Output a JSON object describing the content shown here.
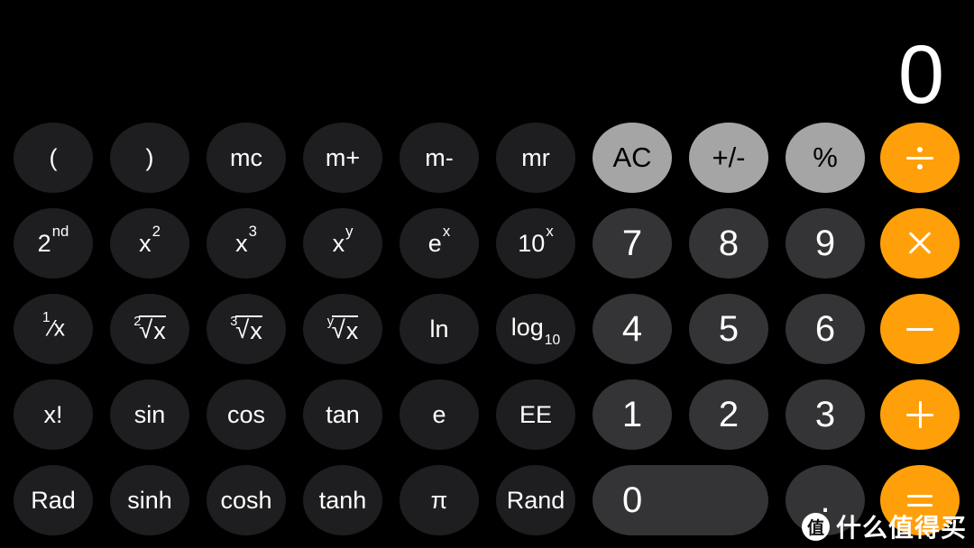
{
  "app": {
    "name": "Calculator",
    "mode": "scientific",
    "orientation": "landscape"
  },
  "display": {
    "value": "0"
  },
  "colors": {
    "background": "#000000",
    "function_key": "#1e1e20",
    "digit_key": "#343436",
    "clear_key": "#a5a5a5",
    "accent_operator": "#ff9f0a",
    "text_light": "#ffffff",
    "text_dark": "#000000"
  },
  "keypad": {
    "rows": [
      {
        "keys": [
          {
            "name": "open-paren",
            "label": "(",
            "style": "function"
          },
          {
            "name": "close-paren",
            "label": ")",
            "style": "function"
          },
          {
            "name": "memory-clear",
            "label": "mc",
            "style": "function"
          },
          {
            "name": "memory-add",
            "label": "m+",
            "style": "function"
          },
          {
            "name": "memory-subtract",
            "label": "m-",
            "style": "function"
          },
          {
            "name": "memory-recall",
            "label": "mr",
            "style": "function"
          },
          {
            "name": "all-clear",
            "label": "AC",
            "style": "gray"
          },
          {
            "name": "plus-minus",
            "label": "+/-",
            "style": "gray"
          },
          {
            "name": "percent",
            "label": "%",
            "style": "gray"
          },
          {
            "name": "divide",
            "label": "÷",
            "style": "accent",
            "glyph": "divide-icon"
          }
        ]
      },
      {
        "keys": [
          {
            "name": "second-function",
            "label": "2nd",
            "base": "2",
            "sup": "nd",
            "style": "function"
          },
          {
            "name": "x-squared",
            "label": "x²",
            "base": "x",
            "sup": "2",
            "style": "function"
          },
          {
            "name": "x-cubed",
            "label": "x³",
            "base": "x",
            "sup": "3",
            "style": "function"
          },
          {
            "name": "x-to-the-y",
            "label": "xʸ",
            "base": "x",
            "sup": "y",
            "style": "function"
          },
          {
            "name": "e-to-the-x",
            "label": "eˣ",
            "base": "e",
            "sup": "x",
            "style": "function"
          },
          {
            "name": "ten-to-the-x",
            "label": "10ˣ",
            "base": "10",
            "sup": "x",
            "style": "function"
          },
          {
            "name": "digit-7",
            "label": "7",
            "style": "digit"
          },
          {
            "name": "digit-8",
            "label": "8",
            "style": "digit"
          },
          {
            "name": "digit-9",
            "label": "9",
            "style": "digit"
          },
          {
            "name": "multiply",
            "label": "×",
            "style": "accent",
            "glyph": "multiply-icon"
          }
        ]
      },
      {
        "keys": [
          {
            "name": "reciprocal",
            "label": "¹⁄x",
            "style": "function",
            "kind": "fraction",
            "numerator": "1",
            "denominator": "x"
          },
          {
            "name": "square-root",
            "label": "²√x",
            "style": "function",
            "kind": "radical",
            "index": "2",
            "radicand": "x"
          },
          {
            "name": "cube-root",
            "label": "³√x",
            "style": "function",
            "kind": "radical",
            "index": "3",
            "radicand": "x"
          },
          {
            "name": "y-root",
            "label": "ʸ√x",
            "style": "function",
            "kind": "radical",
            "index": "y",
            "radicand": "x"
          },
          {
            "name": "natural-log",
            "label": "ln",
            "style": "function"
          },
          {
            "name": "log-base-ten",
            "label": "log₁₀",
            "base": "log",
            "sub": "10",
            "style": "function"
          },
          {
            "name": "digit-4",
            "label": "4",
            "style": "digit"
          },
          {
            "name": "digit-5",
            "label": "5",
            "style": "digit"
          },
          {
            "name": "digit-6",
            "label": "6",
            "style": "digit"
          },
          {
            "name": "subtract",
            "label": "−",
            "style": "accent",
            "glyph": "minus-icon"
          }
        ]
      },
      {
        "keys": [
          {
            "name": "factorial",
            "label": "x!",
            "style": "function"
          },
          {
            "name": "sine",
            "label": "sin",
            "style": "function"
          },
          {
            "name": "cosine",
            "label": "cos",
            "style": "function"
          },
          {
            "name": "tangent",
            "label": "tan",
            "style": "function"
          },
          {
            "name": "euler-constant",
            "label": "e",
            "style": "function"
          },
          {
            "name": "exponent-entry",
            "label": "EE",
            "style": "function"
          },
          {
            "name": "digit-1",
            "label": "1",
            "style": "digit"
          },
          {
            "name": "digit-2",
            "label": "2",
            "style": "digit"
          },
          {
            "name": "digit-3",
            "label": "3",
            "style": "digit"
          },
          {
            "name": "add",
            "label": "+",
            "style": "accent",
            "glyph": "plus-icon"
          }
        ]
      },
      {
        "keys": [
          {
            "name": "angle-mode-rad",
            "label": "Rad",
            "style": "function"
          },
          {
            "name": "hyperbolic-sine",
            "label": "sinh",
            "style": "function"
          },
          {
            "name": "hyperbolic-cosine",
            "label": "cosh",
            "style": "function"
          },
          {
            "name": "hyperbolic-tangent",
            "label": "tanh",
            "style": "function"
          },
          {
            "name": "pi-constant",
            "label": "π",
            "style": "function"
          },
          {
            "name": "random",
            "label": "Rand",
            "style": "function"
          },
          {
            "name": "digit-0",
            "label": "0",
            "style": "digit",
            "wide": true
          },
          {
            "name": "decimal-point",
            "label": ".",
            "style": "digit"
          },
          {
            "name": "equals",
            "label": "=",
            "style": "accent",
            "glyph": "equals-icon"
          }
        ]
      }
    ]
  },
  "watermark": {
    "badge": "值",
    "text": "什么值得买"
  }
}
